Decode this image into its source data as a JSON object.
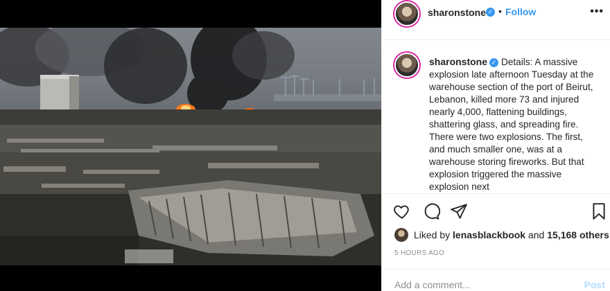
{
  "post": {
    "photo_alt": "",
    "header": {
      "username": "sharonstone",
      "separator": "•",
      "follow_label": "Follow",
      "more_label": "•••"
    },
    "caption": {
      "username": "sharonstone",
      "text": "Details: A massive explosion late afternoon Tuesday at the warehouse section of the port of Beirut, Lebanon, killed more 73 and injured nearly 4,000, flattening buildings, shattering glass, and spreading fire. There were two explosions. The first, and much smaller one, was at a warehouse storing fireworks. But that explosion triggered the massive explosion next"
    },
    "likes": {
      "prefix": "Liked by ",
      "liker": "lenasblackbook",
      "middle": " and ",
      "count": "15,168 others"
    },
    "time": "5 HOURS AGO",
    "comment": {
      "placeholder": "Add a comment...",
      "post_label": "Post"
    },
    "icons": {
      "like": "heart-icon",
      "comment": "comment-icon",
      "share": "share-icon",
      "save": "bookmark-icon",
      "verified": "verified-badge-icon"
    },
    "colors": {
      "accent": "#3897f0",
      "post_disabled": "#b3dbff",
      "muted": "#8e8e8e"
    }
  }
}
